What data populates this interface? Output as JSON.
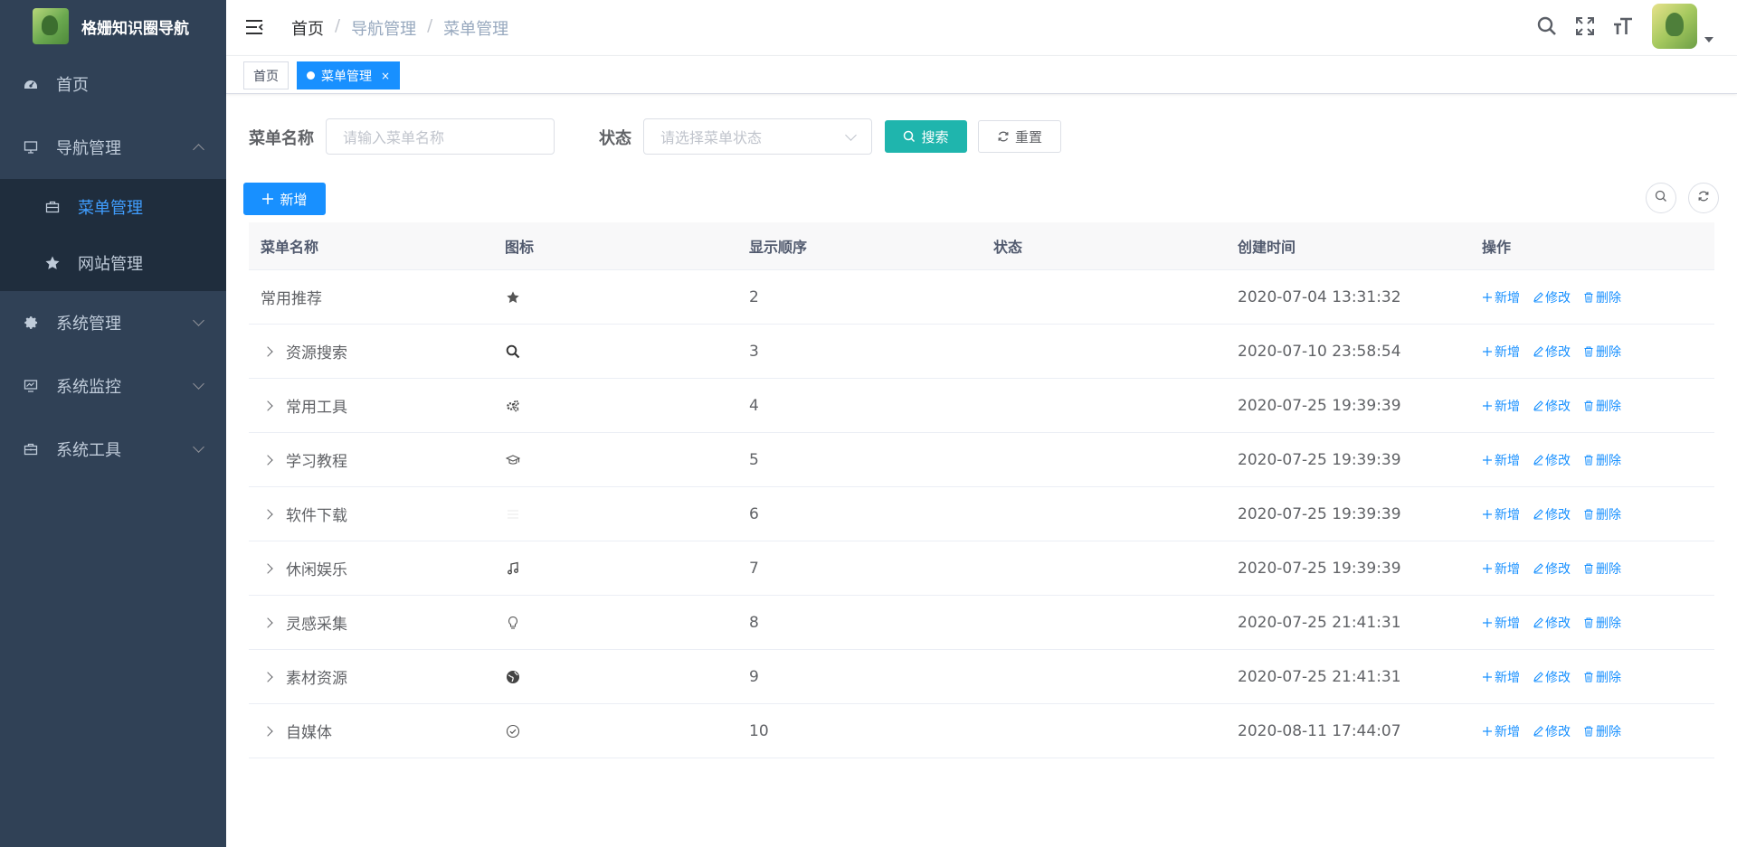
{
  "app": {
    "title": "格姗知识圈导航"
  },
  "sidebar": {
    "items": [
      {
        "label": "首页",
        "icon": "dashboard-icon"
      },
      {
        "label": "导航管理",
        "icon": "monitor-icon",
        "expanded": true,
        "children": [
          {
            "label": "菜单管理",
            "icon": "briefcase-icon",
            "active": true
          },
          {
            "label": "网站管理",
            "icon": "star-icon"
          }
        ]
      },
      {
        "label": "系统管理",
        "icon": "gear-icon"
      },
      {
        "label": "系统监控",
        "icon": "monitor-chart-icon"
      },
      {
        "label": "系统工具",
        "icon": "toolbox-icon"
      }
    ]
  },
  "breadcrumb": [
    "首页",
    "导航管理",
    "菜单管理"
  ],
  "tags": [
    {
      "label": "首页",
      "active": false
    },
    {
      "label": "菜单管理",
      "active": true,
      "close": "×"
    }
  ],
  "search": {
    "name_label": "菜单名称",
    "name_placeholder": "请输入菜单名称",
    "status_label": "状态",
    "status_placeholder": "请选择菜单状态",
    "search_button": "搜索",
    "reset_button": "重置"
  },
  "toolbar": {
    "add_button": "新增"
  },
  "table": {
    "columns": [
      "菜单名称",
      "图标",
      "显示顺序",
      "状态",
      "创建时间",
      "操作"
    ],
    "actions": {
      "add": "新增",
      "edit": "修改",
      "delete": "删除"
    },
    "rows": [
      {
        "name": "常用推荐",
        "icon": "star-icon",
        "order": "2",
        "status": "",
        "created": "2020-07-04 13:31:32",
        "expandable": false
      },
      {
        "name": "资源搜索",
        "icon": "search-icon",
        "order": "3",
        "status": "",
        "created": "2020-07-10 23:58:54",
        "expandable": true
      },
      {
        "name": "常用工具",
        "icon": "gears-icon",
        "order": "4",
        "status": "",
        "created": "2020-07-25 19:39:39",
        "expandable": true
      },
      {
        "name": "学习教程",
        "icon": "graduation-cap-icon",
        "order": "5",
        "status": "",
        "created": "2020-07-25 19:39:39",
        "expandable": true
      },
      {
        "name": "软件下载",
        "icon": "list-icon",
        "order": "6",
        "status": "",
        "created": "2020-07-25 19:39:39",
        "expandable": true
      },
      {
        "name": "休闲娱乐",
        "icon": "music-icon",
        "order": "7",
        "status": "",
        "created": "2020-07-25 19:39:39",
        "expandable": true
      },
      {
        "name": "灵感采集",
        "icon": "lightbulb-icon",
        "order": "8",
        "status": "",
        "created": "2020-07-25 21:41:31",
        "expandable": true
      },
      {
        "name": "素材资源",
        "icon": "globe-icon",
        "order": "9",
        "status": "",
        "created": "2020-07-25 21:41:31",
        "expandable": true
      },
      {
        "name": "自媒体",
        "icon": "check-circle-icon",
        "order": "10",
        "status": "",
        "created": "2020-08-11 17:44:07",
        "expandable": true
      }
    ]
  },
  "colors": {
    "sidebar_bg": "#304156",
    "submenu_bg": "#1f2d3d",
    "primary": "#1890ff",
    "search_btn": "#1fb5ad"
  }
}
